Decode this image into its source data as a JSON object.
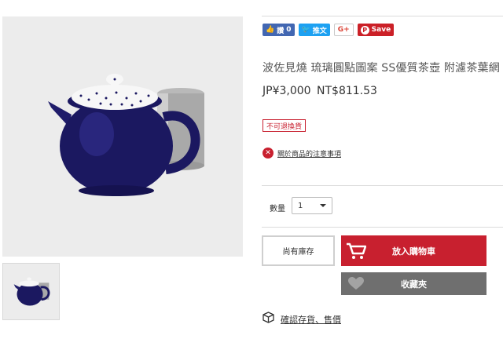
{
  "share": {
    "facebook_label": "讚",
    "facebook_count": "0",
    "twitter_label": "推文",
    "google_label": "G+",
    "pinterest_label": "Save"
  },
  "product": {
    "title": "波佐見燒 琉璃圓點圖案 SS優質茶壺 附濾茶葉網",
    "price": "JP¥3,000  NT$811.53",
    "badge": "不可退換貨",
    "notice_link": "關於商品的注意事項"
  },
  "quantity": {
    "label": "數量",
    "value": "1"
  },
  "actions": {
    "stock_label": "尚有庫存",
    "cart_label": "放入購物車",
    "favorite_label": "收藏夾",
    "confirm_link": "確認存貨、售價"
  },
  "colors": {
    "accent_red": "#c8202f",
    "favorite_gray": "#6f6f6f",
    "teapot_blue": "#1b1860"
  },
  "icons": {
    "facebook": "thumbs-up-icon",
    "twitter": "twitter-bird-icon",
    "pinterest": "pinterest-icon",
    "notice": "warning-circle-icon",
    "cart": "shopping-cart-icon",
    "favorite": "heart-icon",
    "confirm": "box-icon"
  }
}
